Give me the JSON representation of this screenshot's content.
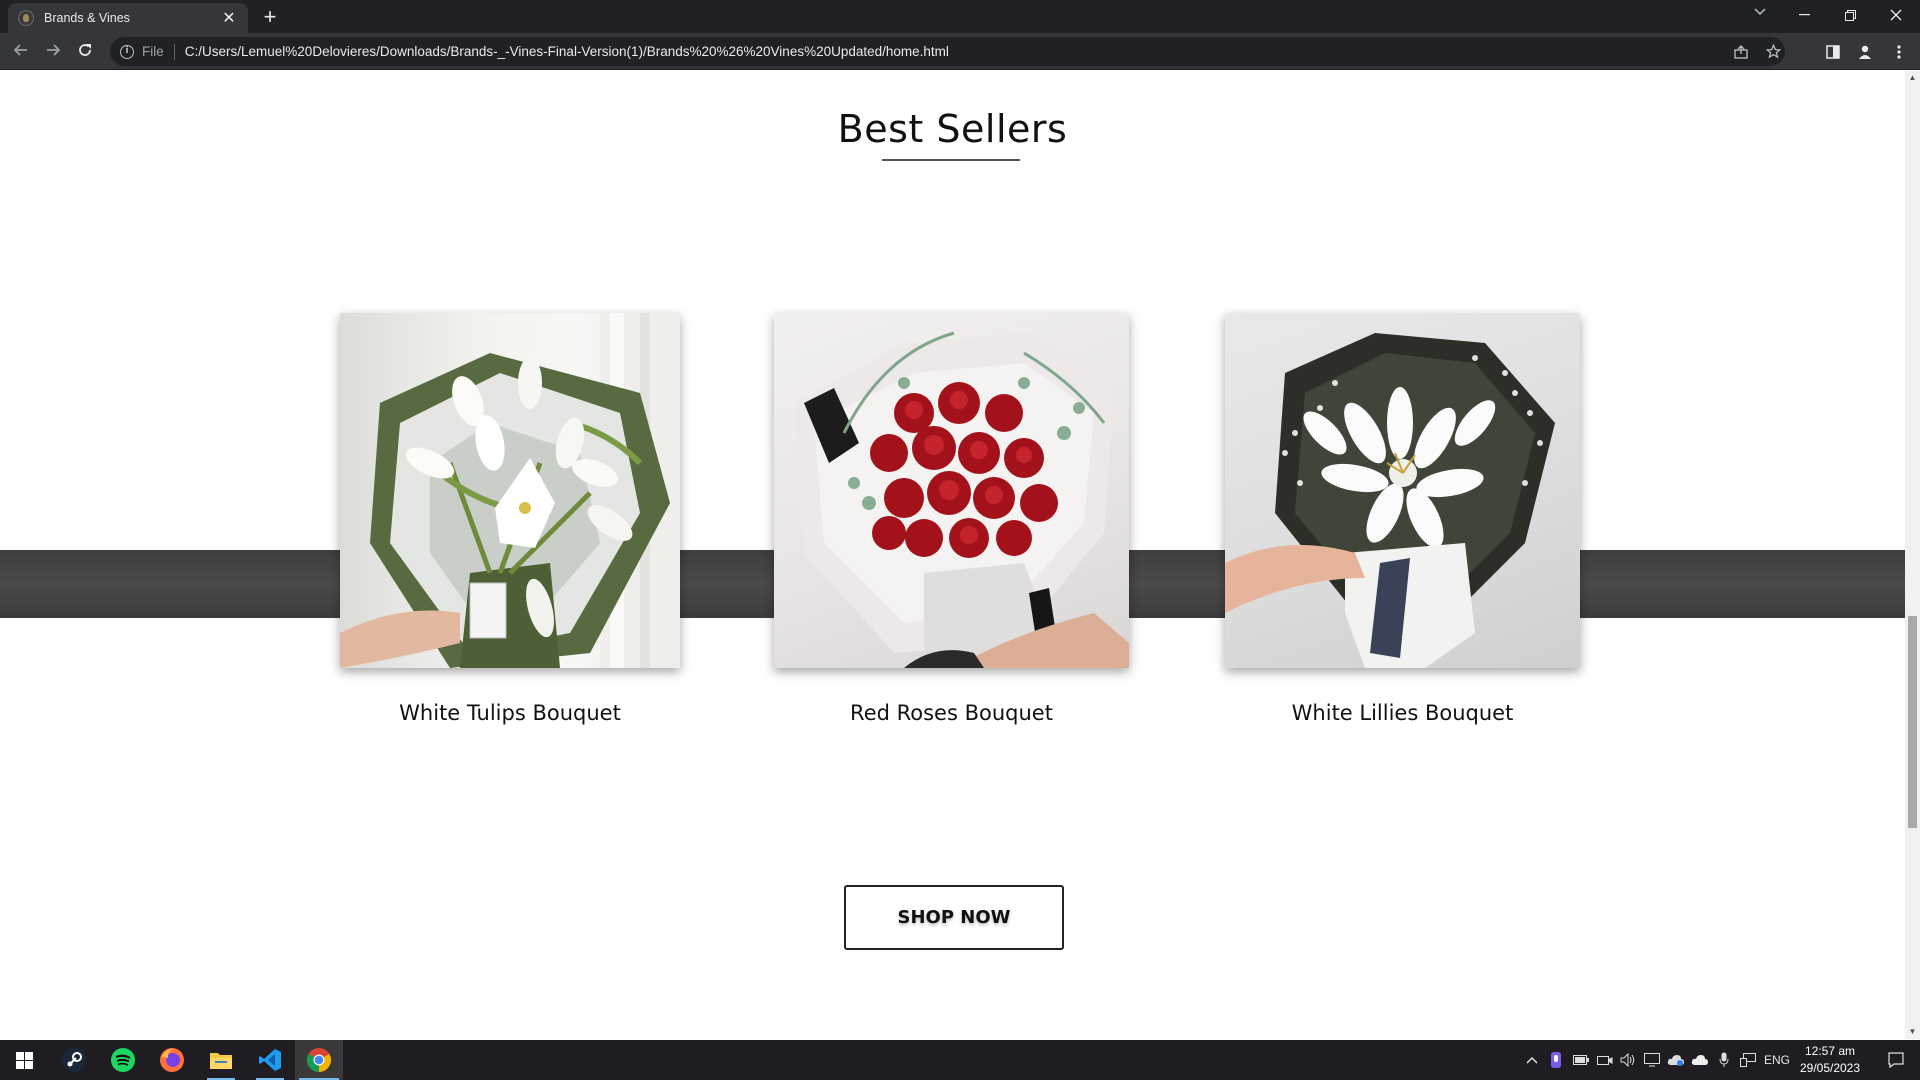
{
  "browser": {
    "tab_title": "Brands & Vines",
    "tab_close": "✕",
    "new_tab": "+",
    "file_label": "File",
    "url": "C:/Users/Lemuel%20Delovieres/Downloads/Brands-_-Vines-Final-Version(1)/Brands%20%26%20Vines%20Updated/home.html"
  },
  "page": {
    "section_title": "Best Sellers",
    "products": [
      {
        "name": "White Tulips Bouquet"
      },
      {
        "name": "Red Roses Bouquet"
      },
      {
        "name": "White Lillies Bouquet"
      }
    ],
    "shop_button": "SHOP NOW"
  },
  "taskbar": {
    "apps": [
      "windows-start",
      "steam",
      "spotify",
      "firefox",
      "file-explorer",
      "vscode",
      "chrome"
    ],
    "language": "ENG",
    "time": "12:57 am",
    "date": "29/05/2023"
  },
  "colors": {
    "chrome_dark": "#202124",
    "chrome_toolbar": "#35363a",
    "band": "#444444",
    "taskbar": "#1f1d22",
    "accent_blue": "#76b9ed"
  }
}
